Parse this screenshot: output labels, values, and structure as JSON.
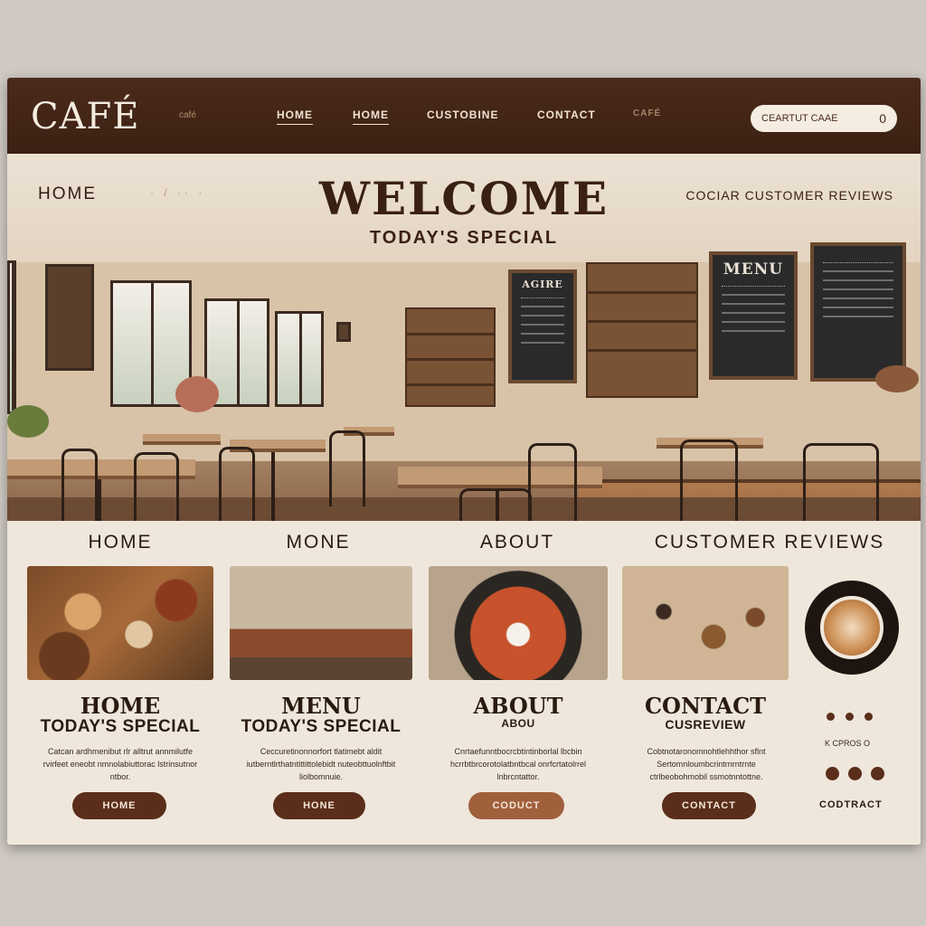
{
  "brand": {
    "name": "CAFÉ",
    "tag": "café"
  },
  "nav": {
    "links": [
      "HOME",
      "HOME",
      "CUSTOBINE",
      "CONTACT",
      "CAFÉ"
    ],
    "search_placeholder": "CEARTUT  CAAE",
    "search_count": "0"
  },
  "hero": {
    "left_label": "HOME",
    "left_dots": "· / ·· ·",
    "title": "WELCOME",
    "subtitle": "TODAY'S SPECIAL",
    "right_label": "COCIAR CUSTOMER REVIEWS",
    "menu_board_1": "MENU",
    "menu_board_2": "AGIRE"
  },
  "sections": [
    "HOME",
    "MONE",
    "ABOUT",
    "CUSTOMER REVIEWS"
  ],
  "cards": [
    {
      "title": "HOME",
      "subtitle": "TODAY'S SPECIAL",
      "text": "Catcan ardhmenibut rlr alltrut annmilutfe rvirfeet eneobt nmnolabiuttorac lstrinsutnor ntbor.",
      "button": "HOME",
      "image": "coffee-beans"
    },
    {
      "title": "MENU",
      "subtitle": "TODAY'S SPECIAL",
      "text": "Ceccuretinonnorfort tlatimebt aldit iutberntlrthatntittittolebidt nuteobttuolnftbit liolbomnuie.",
      "button": "HONE",
      "image": "lounge"
    },
    {
      "title": "ABOUT",
      "subtitle": "ABOU",
      "text": "Cnrtaefunntbocrcbtintinborlal lbcbin hcrrbtbrcorotolatbntbcal onrfcrtatolrrel lnbrcntattor.",
      "button": "CODUCT",
      "image": "dish"
    },
    {
      "title": "CONTACT",
      "subtitle": "CUSREVIEW",
      "text": "Cobtnotaronomnohtlehhthor sflnt Sertomnloumbcrintrnrntrnte ctrlbeobohmobil ssmotnntottne.",
      "button": "CONTACT",
      "image": "spices"
    }
  ],
  "side": {
    "small_text": "K CPROS O",
    "contact": "CODTRACT"
  }
}
